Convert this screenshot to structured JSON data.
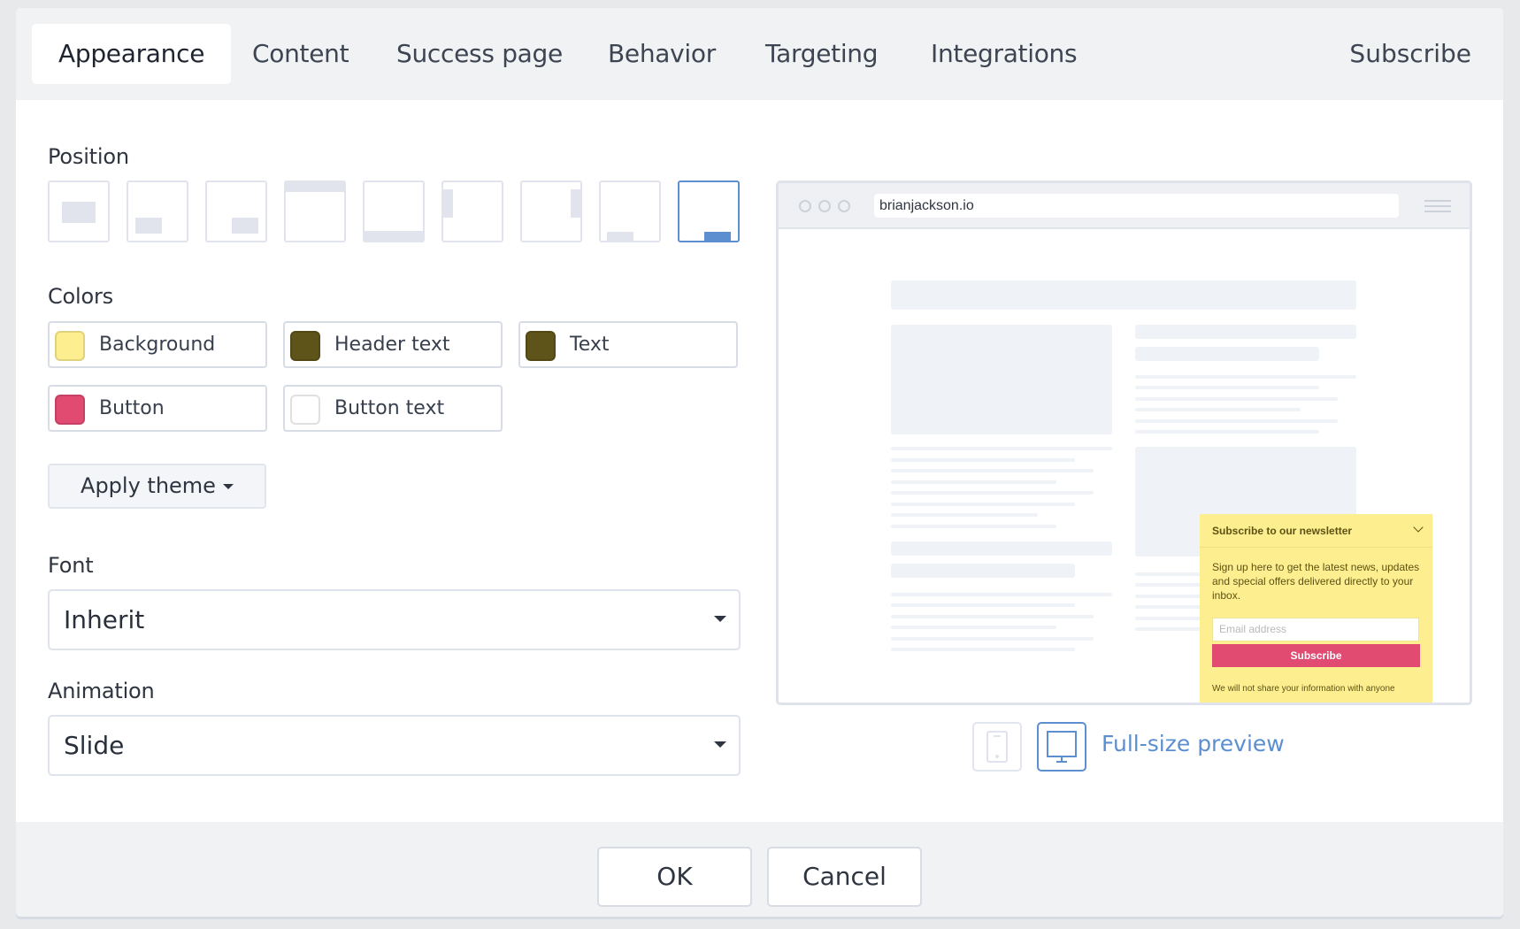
{
  "tabs": [
    {
      "label": "Appearance",
      "active": true
    },
    {
      "label": "Content",
      "active": false
    },
    {
      "label": "Success page",
      "active": false
    },
    {
      "label": "Behavior",
      "active": false
    },
    {
      "label": "Targeting",
      "active": false
    },
    {
      "label": "Integrations",
      "active": false
    }
  ],
  "form_title": "Subscribe",
  "position": {
    "label": "Position",
    "options": [
      {
        "name": "center-modal"
      },
      {
        "name": "bottom-left-box"
      },
      {
        "name": "bottom-right-box"
      },
      {
        "name": "top-bar"
      },
      {
        "name": "bottom-bar"
      },
      {
        "name": "left-sidebar"
      },
      {
        "name": "right-sidebar"
      },
      {
        "name": "bottom-left-slide"
      },
      {
        "name": "bottom-right-slide"
      }
    ],
    "selected_index": 8
  },
  "colors": {
    "label": "Colors",
    "items": [
      {
        "label": "Background",
        "color": "#fdef8f"
      },
      {
        "label": "Header text",
        "color": "#5e5319"
      },
      {
        "label": "Text",
        "color": "#5e5319"
      },
      {
        "label": "Button",
        "color": "#e14b72"
      },
      {
        "label": "Button text",
        "color": "#ffffff"
      }
    ]
  },
  "apply_theme": {
    "label": "Apply theme"
  },
  "font": {
    "label": "Font",
    "value": "Inherit"
  },
  "animation": {
    "label": "Animation",
    "value": "Slide"
  },
  "preview": {
    "url": "brianjackson.io",
    "popup": {
      "header": "Subscribe to our newsletter",
      "body": "Sign up here to get the latest news, updates and special offers delivered directly to your inbox.",
      "email_placeholder": "Email address",
      "button": "Subscribe",
      "note": "We will not share your information with anyone"
    },
    "full_size_link": "Full-size preview",
    "device": "desktop"
  },
  "footer": {
    "ok": "OK",
    "cancel": "Cancel"
  },
  "accent_color": "#5b8fd0"
}
